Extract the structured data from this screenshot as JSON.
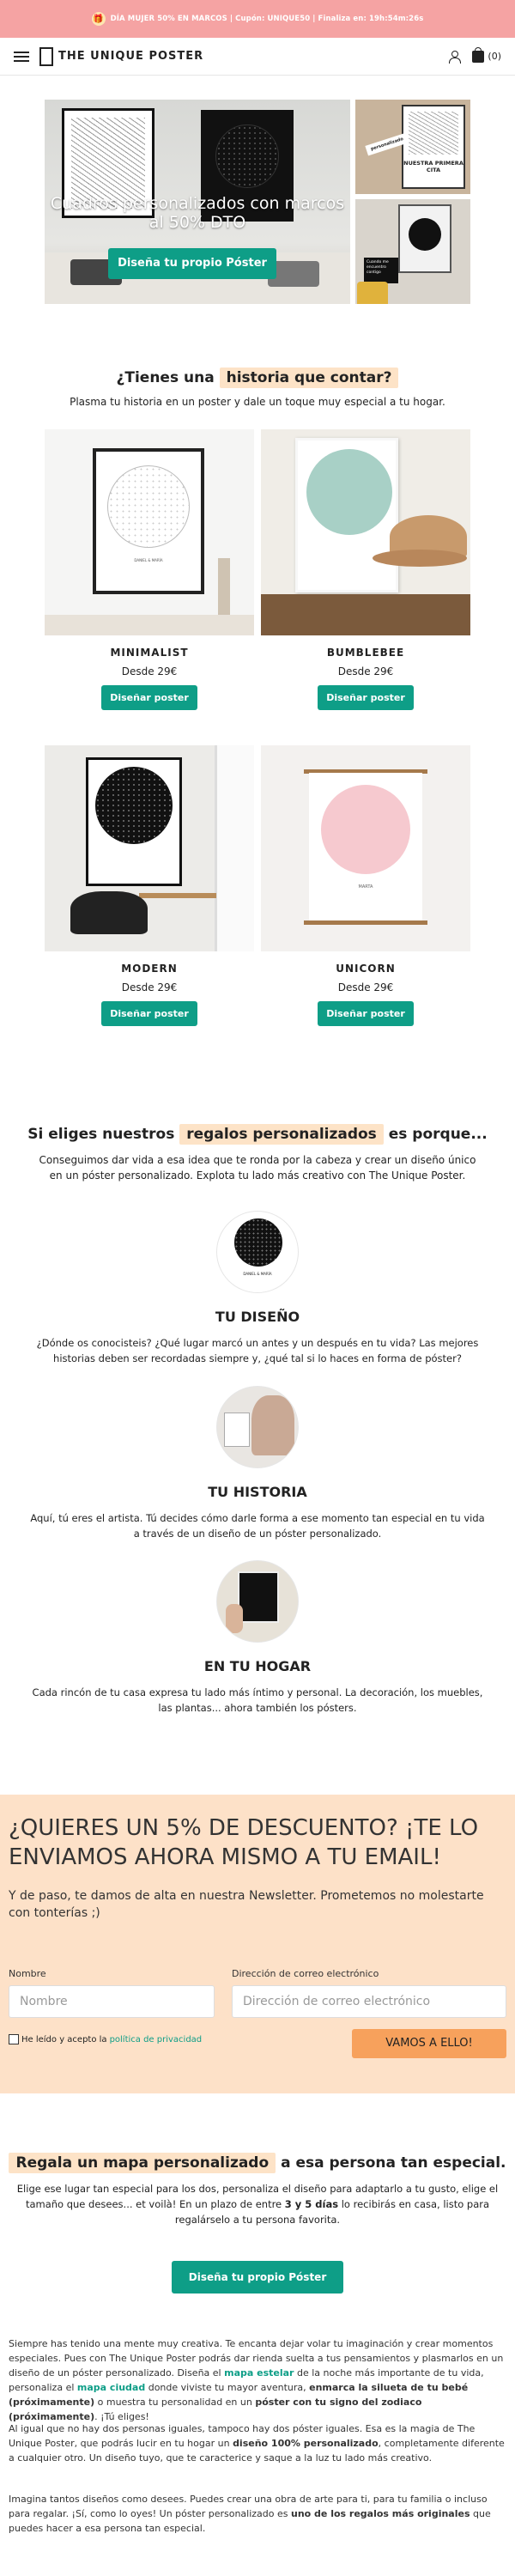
{
  "promo": {
    "text": "DÍA MUJER 50% EN MARCOS | Cupón: UNIQUE50 | Finaliza en: 19h:54m:26s"
  },
  "nav": {
    "brand": "THE UNIQUE POSTER",
    "cart_count": "(0)"
  },
  "hero": {
    "title": "Cuadros personalizados con marcos al 50% DTO",
    "cta": "Diseña tu propio Póster",
    "side_poster_title": "NUESTRA PRIMERA CITA",
    "side_ribbon": "personalizado",
    "side_tag": "Cuando me encuentro contigo"
  },
  "story": {
    "title_pre": "¿Tienes una",
    "title_hl": "historia que contar?",
    "subtitle": "Plasma tu historia en un poster y dale un toque muy especial a tu hogar."
  },
  "products": [
    {
      "name": "MINIMALIST",
      "price": "Desde 29€",
      "cta": "Diseñar poster",
      "caption": "DANIEL & MARÍA"
    },
    {
      "name": "BUMBLEBEE",
      "price": "Desde 29€",
      "cta": "Diseñar poster"
    },
    {
      "name": "MODERN",
      "price": "Desde 29€",
      "cta": "Diseñar poster"
    },
    {
      "name": "UNICORN",
      "price": "Desde 29€",
      "cta": "Diseñar poster",
      "caption": "MARTA"
    }
  ],
  "gifts": {
    "title_pre": "Si eliges nuestros",
    "title_hl": "regalos personalizados",
    "title_post": "es porque...",
    "subtitle": "Conseguimos dar vida a esa idea que te ronda por la cabeza y crear un diseño único en un póster personalizado. Explota tu lado más creativo con The Unique Poster.",
    "features": [
      {
        "title": "TU DISEÑO",
        "caption": "DANIEL & MARÍA",
        "text": "¿Dónde os conocisteis? ¿Qué lugar marcó un antes y un después en tu vida? Las mejores historias deben ser recordadas siempre y, ¿qué tal si lo haces en forma de póster?"
      },
      {
        "title": "TU HISTORIA",
        "text": "Aquí, tú eres el artista. Tú decides cómo darle forma a ese momento tan especial en tu vida a través de un diseño de un póster personalizado."
      },
      {
        "title": "EN TU HOGAR",
        "text": "Cada rincón de tu casa expresa tu lado más íntimo y personal. La decoración, los muebles, las plantas... ahora también los pósters."
      }
    ]
  },
  "newsletter": {
    "title": "¿QUIERES UN 5% DE DESCUENTO? ¡TE LO ENVIAMOS AHORA MISMO A TU EMAIL!",
    "desc": "Y de paso, te damos de alta en nuestra Newsletter. Prometemos no molestarte con tonterías ;)",
    "name_label": "Nombre",
    "name_placeholder": "Nombre",
    "email_label": "Dirección de correo electrónico",
    "email_placeholder": "Dirección de correo electrónico",
    "consent": "He leído y acepto la",
    "consent_link": "política de privacidad",
    "submit": "VAMOS A ELLO!"
  },
  "gift2": {
    "title_hl": "Regala un mapa personalizado",
    "title_post": "a esa persona tan especial.",
    "sub_1": "Elige ese lugar tan especial para los dos, personaliza el diseño para adaptarlo a tu gusto, elige el tamaño que desees... et voilà! En un plazo de entre",
    "sub_b": "3 y 5 días",
    "sub_2": "lo recibirás en casa, listo para regalárselo a tu persona favorita.",
    "cta": "Diseña tu propio Póster"
  },
  "body": {
    "p1_a": "Siempre has tenido una mente muy creativa. Te encanta dejar volar tu imaginación y crear momentos especiales. Pues con The Unique Poster podrás dar rienda suelta a tus pensamientos y plasmarlos en un diseño de un póster personalizado. Diseña el",
    "p1_g1": "mapa estelar",
    "p1_b": "de la noche más importante de tu vida, personaliza el",
    "p1_g2": "mapa ciudad",
    "p1_c": "donde viviste tu mayor aventura,",
    "p1_b1": "enmarca la silueta de tu bebé (próximamente)",
    "p1_d": "o muestra tu personalidad en un",
    "p1_b2": "póster con tu signo del zodiaco (próximamente)",
    "p1_e": ". ¡Tú eliges!",
    "p2_a": "Al igual que no hay dos personas iguales, tampoco hay dos póster iguales. Esa es la magia de The Unique Poster, que podrás lucir en tu hogar un",
    "p2_b1": "diseño 100% personalizado",
    "p2_b": ", completamente diferente a cualquier otro. Un diseño tuyo, que te caracterice y saque a la luz tu lado más creativo.",
    "p3_a": "Imagina tantos diseños como desees. Puedes crear una obra de arte para ti, para tu familia o incluso para regalar. ¡Sí, como lo oyes! Un póster personalizado es",
    "p3_b1": "uno de los regalos más originales",
    "p3_b": "que puedes hacer a esa persona tan especial."
  },
  "colors": {
    "accent": "#0e9e87",
    "promo": "#f5a3a3",
    "highlight": "#fde3c7",
    "newsletter_bg": "#fde1c8",
    "submit": "#f7a15c"
  }
}
